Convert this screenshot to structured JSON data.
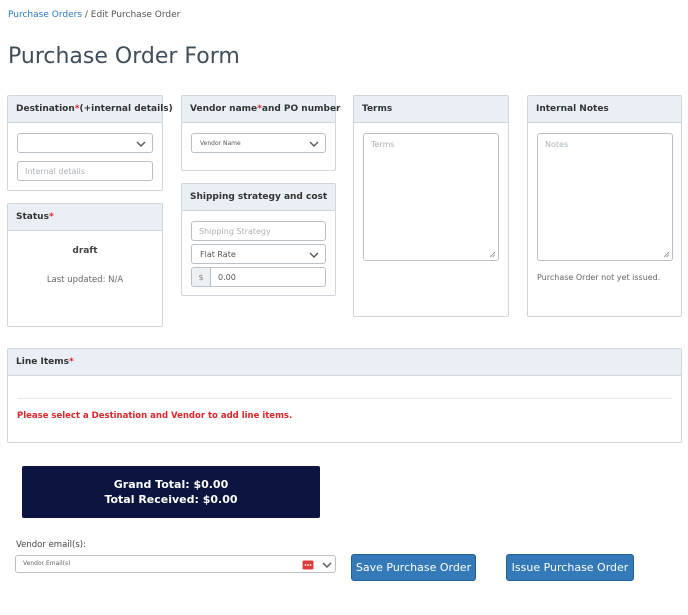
{
  "breadcrumb": {
    "link": "Purchase Orders",
    "separator": " / ",
    "current": "Edit Purchase Order"
  },
  "page_title": "Purchase Order Form",
  "destination": {
    "label": "Destination ",
    "required_mark": "*",
    "suffix": " (+internal details)",
    "select_value": "",
    "internal_placeholder": "Internal details"
  },
  "vendor": {
    "label_a": "Vendor name",
    "required_mark": "*",
    "label_b": " and PO number",
    "select_value": "Vendor Name"
  },
  "terms": {
    "label": "Terms",
    "placeholder": "Terms"
  },
  "notes": {
    "label": "Internal Notes",
    "placeholder": "Notes",
    "status_text": "Purchase Order not yet issued."
  },
  "status": {
    "label": "Status",
    "required_mark": "*",
    "value": "draft",
    "last_updated": "Last updated: N/A"
  },
  "shipping": {
    "label": "Shipping strategy and cost",
    "strategy_placeholder": "Shipping Strategy",
    "method_value": "Flat Rate",
    "currency_symbol": "$",
    "cost_value": "0.00"
  },
  "line_items": {
    "label": "Line Items",
    "required_mark": "*",
    "warning": "Please select a Destination and Vendor to add line items."
  },
  "totals": {
    "grand_total": "Grand Total: $0.00",
    "total_received": "Total Received: $0.00"
  },
  "vendor_email": {
    "label": "Vendor email(s):",
    "placeholder": "Vendor Email(s)"
  },
  "actions": {
    "save": "Save Purchase Order",
    "issue": "Issue Purchase Order"
  },
  "colors": {
    "accent": "#3479b8",
    "required": "#d9262b",
    "dark_panel": "#0b1540",
    "panel_header": "#e9eff5"
  }
}
